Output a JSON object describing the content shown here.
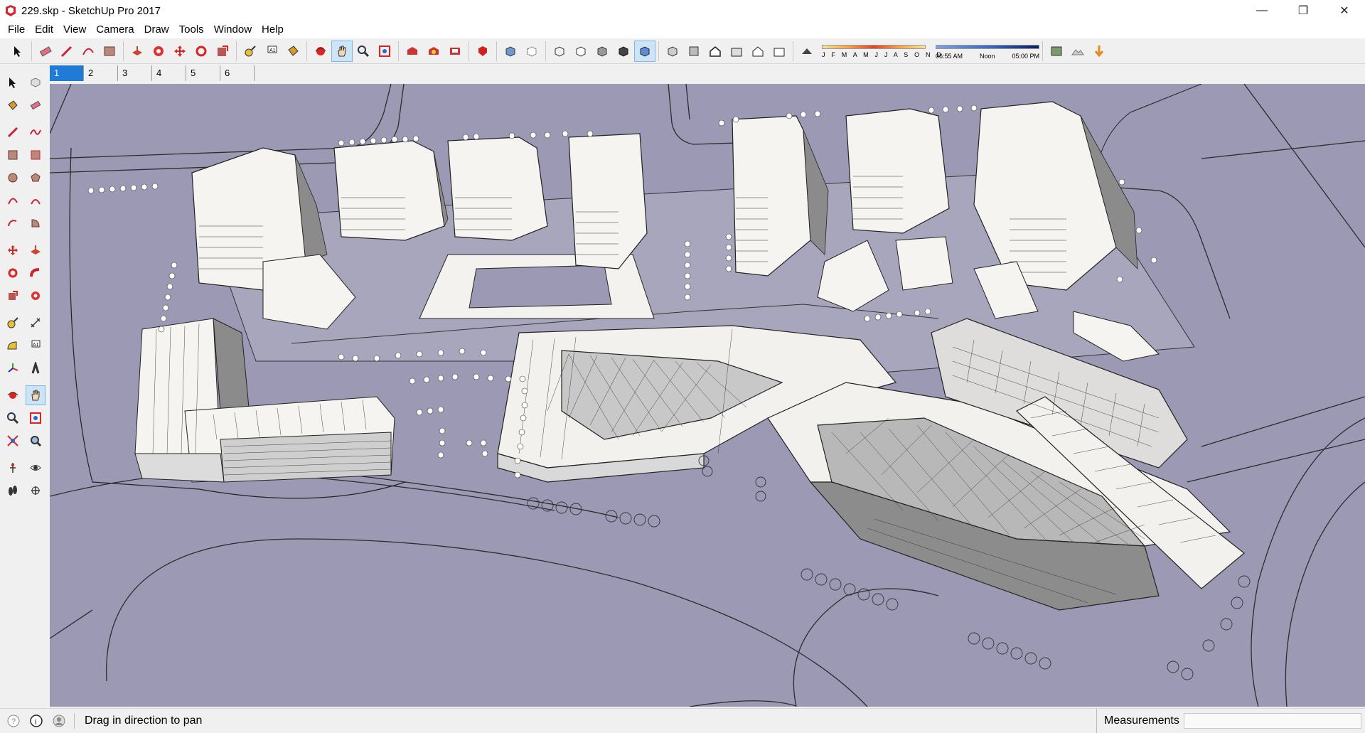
{
  "window": {
    "title": "229.skp - SketchUp Pro 2017"
  },
  "menu": [
    "File",
    "Edit",
    "View",
    "Camera",
    "Draw",
    "Tools",
    "Window",
    "Help"
  ],
  "shadow_settings": {
    "months": "J F M A M J J A S O N D",
    "time_start": "06:55 AM",
    "time_mid": "Noon",
    "time_end": "05:00 PM"
  },
  "scenes": [
    "1",
    "2",
    "3",
    "4",
    "5",
    "6"
  ],
  "active_scene": "1",
  "status": {
    "hint": "Drag in direction to pan",
    "measurements_label": "Measurements",
    "measurements_value": ""
  },
  "colors": {
    "viewport_bg": "#9c99b5",
    "active_scene": "#1f7bd6",
    "active_tool": "#cde4f7"
  }
}
